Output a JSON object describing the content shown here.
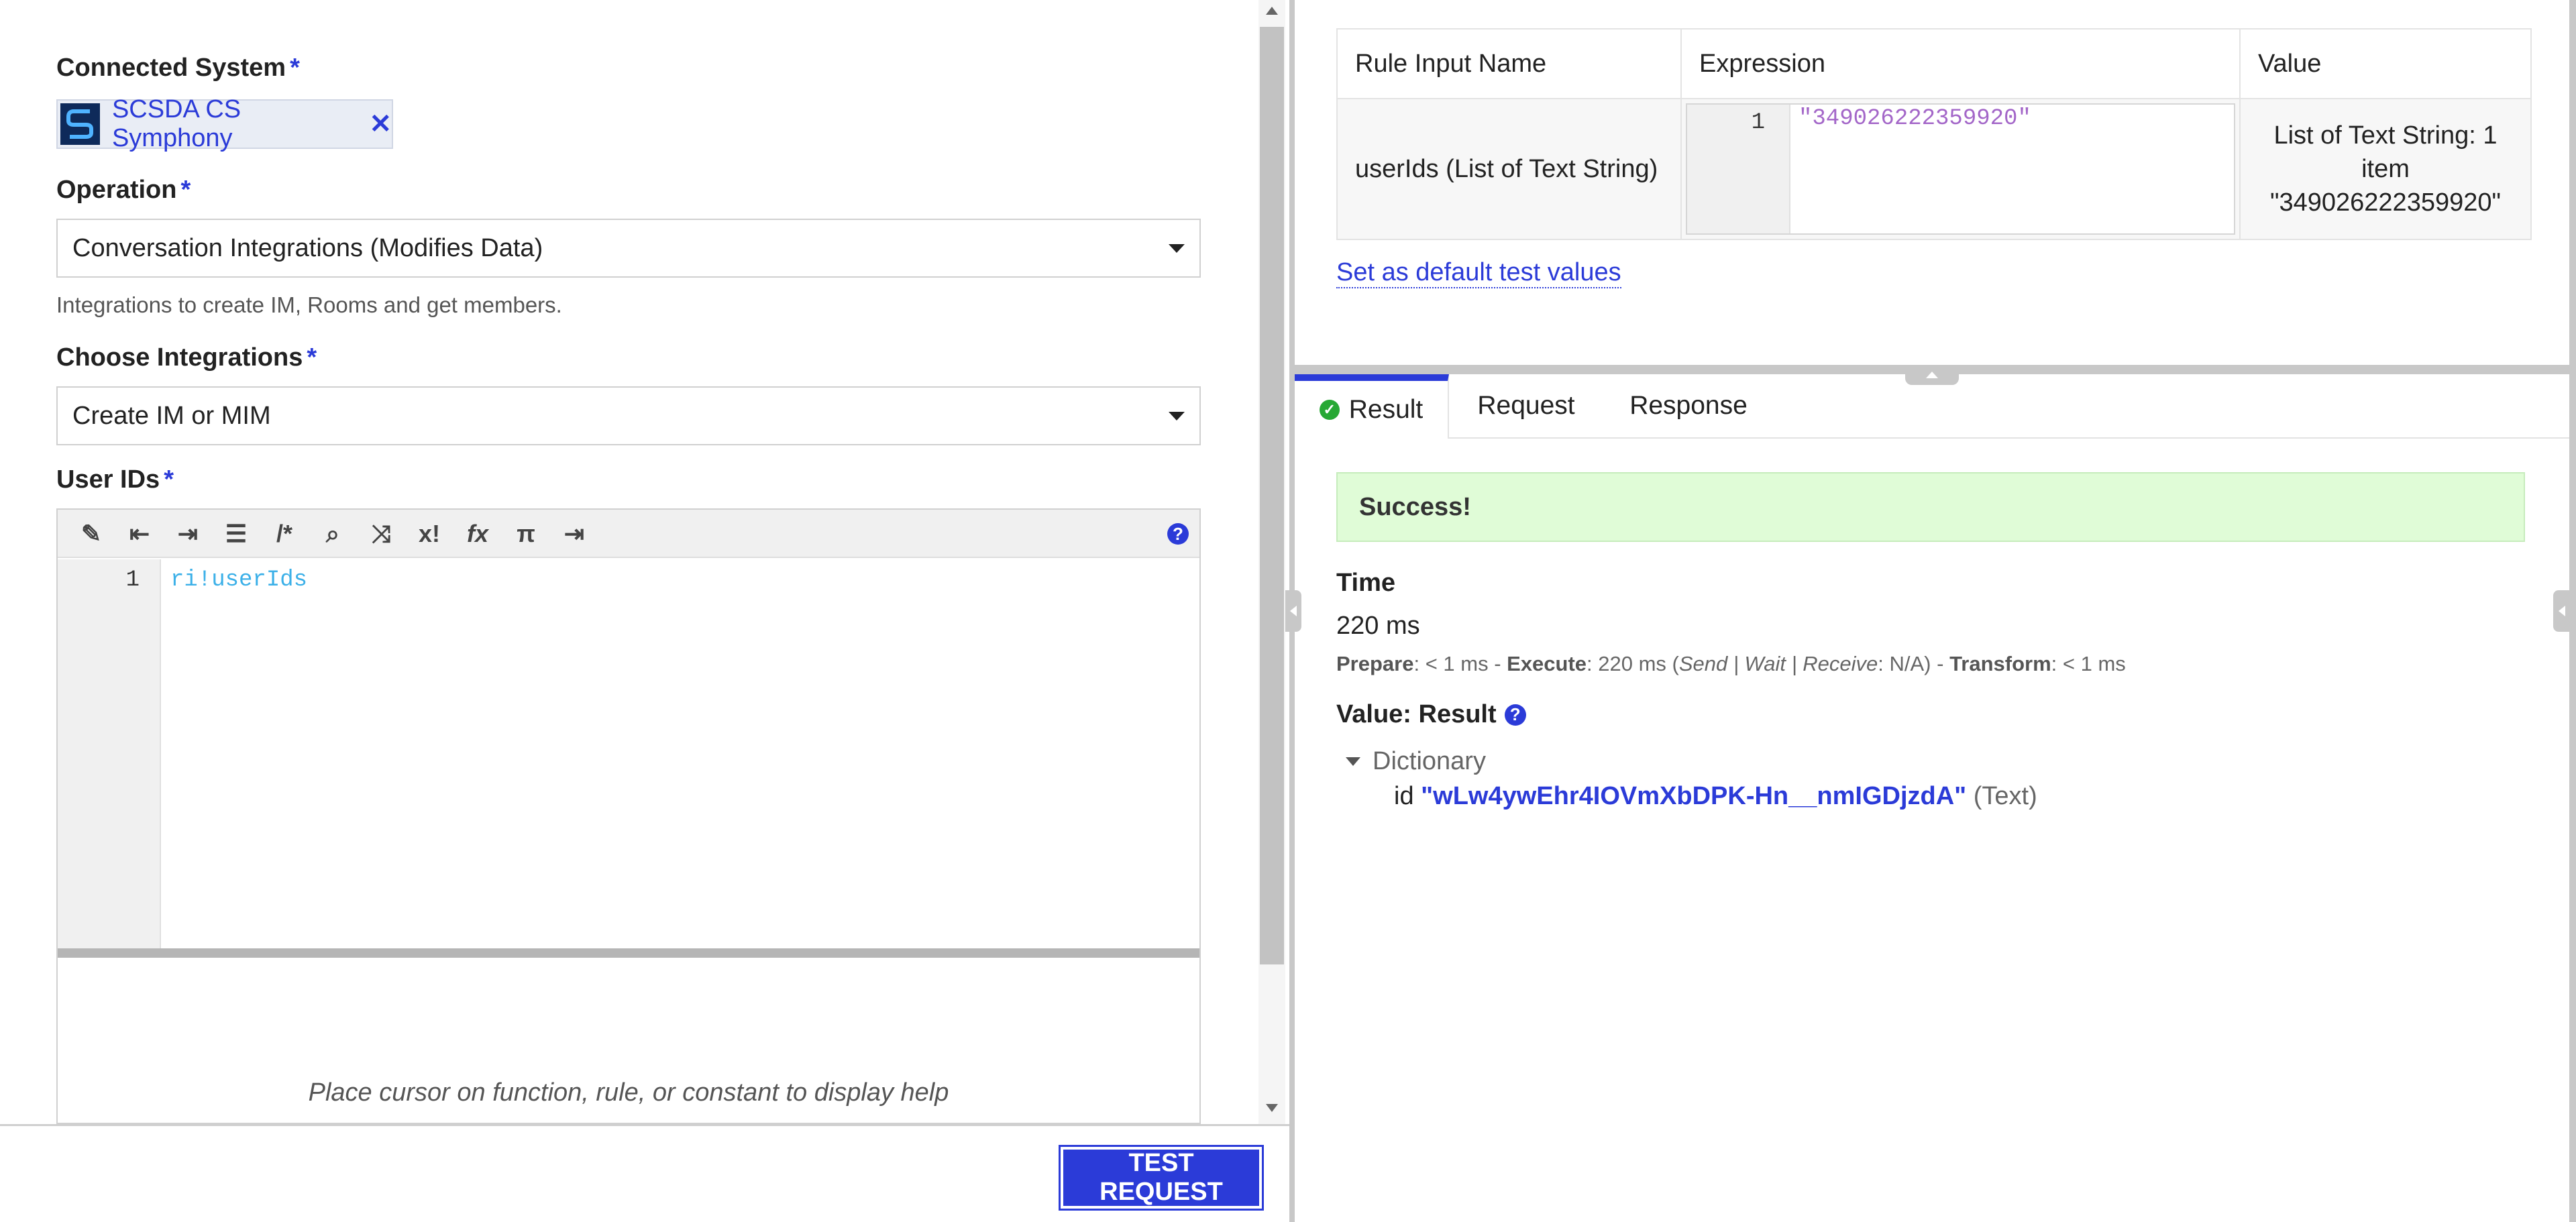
{
  "left": {
    "connected_system_label": "Connected System",
    "required_mark": "*",
    "connected_system_value": "SCSDA CS Symphony",
    "operation_label": "Operation",
    "operation_value": "Conversation Integrations (Modifies Data)",
    "operation_hint": "Integrations to create IM, Rooms and get members.",
    "choose_label": "Choose Integrations",
    "choose_value": "Create IM or MIM",
    "userids_label": "User IDs",
    "editor_line": "1",
    "editor_code": "ri!userIds",
    "editor_help": "Place cursor on function, rule, or constant to display help",
    "toolbar_icons": [
      "magic-wand",
      "outdent",
      "indent",
      "list",
      "comment",
      "search",
      "shuffle",
      "x!",
      "fx",
      "pi",
      "exit"
    ],
    "toolbar_glyphs": [
      "✎",
      "⇤",
      "⇥",
      "☰",
      "/*",
      "⌕",
      "⤨",
      "x!",
      "fx",
      "π",
      "⇥"
    ],
    "help_glyph": "?",
    "test_button": "TEST REQUEST"
  },
  "rule_table": {
    "headers": [
      "Rule Input Name",
      "Expression",
      "Value"
    ],
    "row": {
      "name": "userIds (List of Text String)",
      "expr_line": "1",
      "expression": "\"349026222359920\"",
      "value_line1": "List of Text String: 1 item",
      "value_line2": "\"349026222359920\""
    },
    "default_link": "Set as default test values"
  },
  "result": {
    "tabs": [
      "Result",
      "Request",
      "Response"
    ],
    "success": "Success!",
    "time_label": "Time",
    "time_value": "220 ms",
    "timing": {
      "prepare_label": "Prepare",
      "prepare_val": ": < 1 ms - ",
      "execute_label": "Execute",
      "execute_val": ": 220 ms (",
      "swr": "Send | Wait | Receive",
      "na": ": N/A) - ",
      "transform_label": "Transform",
      "transform_val": ": < 1 ms"
    },
    "value_label": "Value: Result",
    "dict_label": "Dictionary",
    "id_key": "id",
    "id_value": "\"wLw4ywEhr4IOVmXbDPK-Hn__nmIGDjzdA\"",
    "id_type": "(Text)"
  },
  "colors": {
    "accent": "#2b3bd8",
    "success_bg": "#e0fcd7",
    "link": "#2b3bd8"
  }
}
